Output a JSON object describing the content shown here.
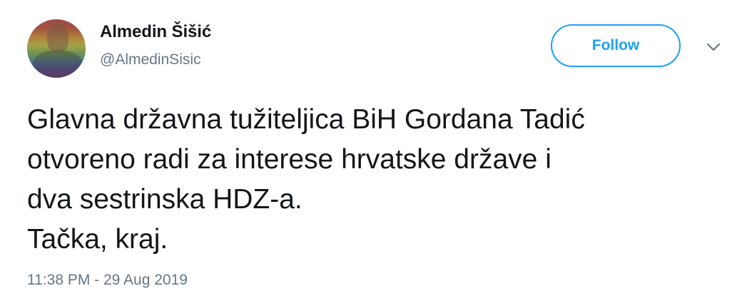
{
  "author": {
    "name": "Almedin Šišić",
    "handle": "@AlmedinSisic",
    "avatar_icon": "avatar-rainbow-photo"
  },
  "follow_button": {
    "label": "Follow",
    "color": "#1da1f2"
  },
  "menu": {
    "icon": "chevron-down-icon"
  },
  "tweet": {
    "lines": [
      "Glavna državna tužiteljica BiH Gordana Tadić",
      "otvoreno radi za interese hrvatske države i",
      "dva sestrinska HDZ-a.",
      "Tačka, kraj."
    ],
    "timestamp": "11:38 PM - 29 Aug 2019"
  },
  "colors": {
    "text_primary": "#14171a",
    "text_secondary": "#657786",
    "accent": "#1da1f2"
  }
}
